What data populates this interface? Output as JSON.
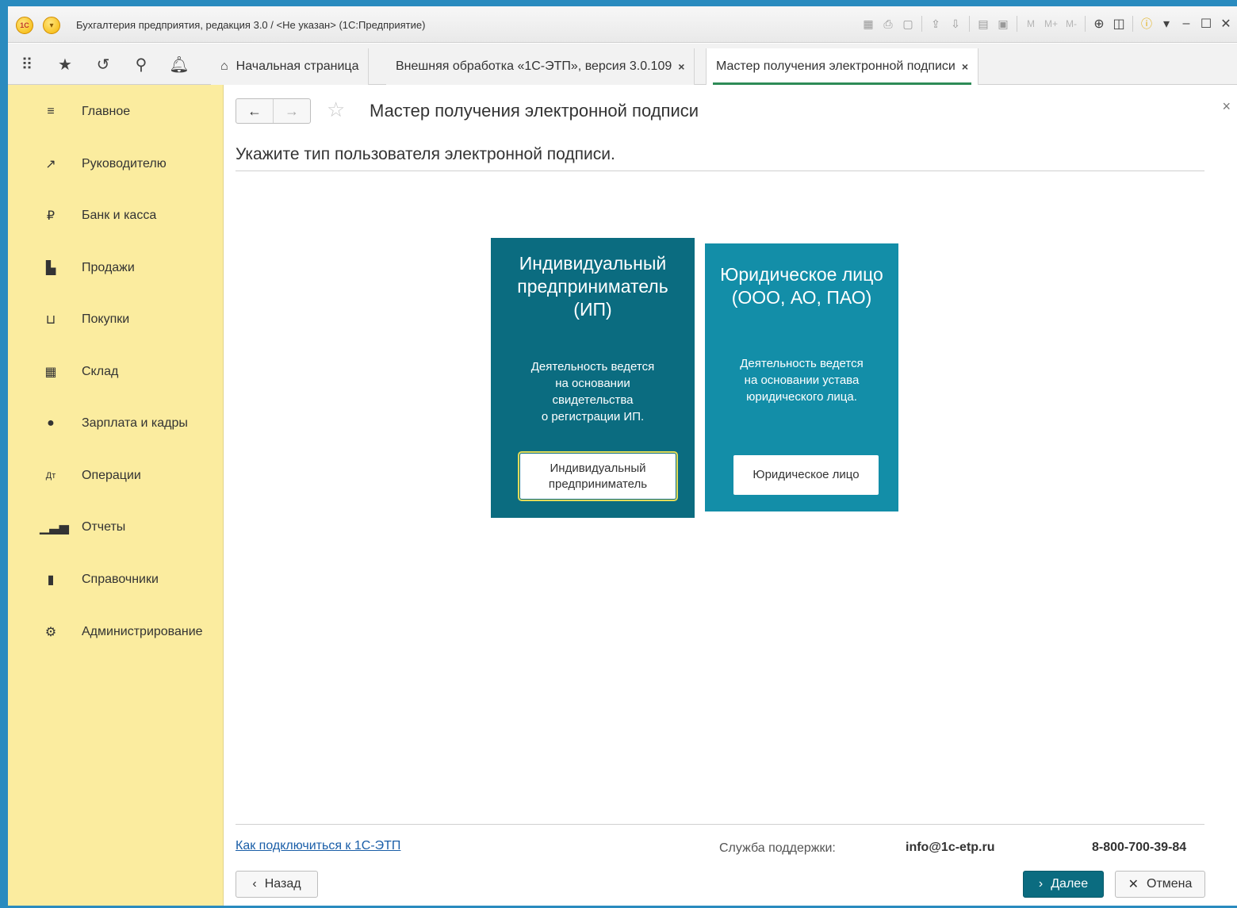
{
  "window": {
    "title": "Бухгалтерия предприятия, редакция 3.0 / <Не указан> (1С:Предприятие)",
    "logo_text": "1С",
    "toolbar_icons": [
      "save-icon",
      "print-icon",
      "preview-icon",
      "upload-icon",
      "download-icon",
      "calculator-icon",
      "calendar-icon"
    ],
    "memory_buttons": [
      "M",
      "M+",
      "M-"
    ],
    "window_controls": [
      "minimize-icon",
      "maximize-icon",
      "close-icon"
    ]
  },
  "tabs": [
    {
      "label": "Начальная страница"
    },
    {
      "label": "Внешняя обработка «1С-ЭТП», версия 3.0.109"
    },
    {
      "label": "Мастер получения электронной подписи"
    }
  ],
  "sidebar": {
    "items": [
      {
        "label": "Главное",
        "icon": "menu-icon"
      },
      {
        "label": "Руководителю",
        "icon": "trend-icon"
      },
      {
        "label": "Банк и касса",
        "icon": "ruble-icon"
      },
      {
        "label": "Продажи",
        "icon": "bag-icon"
      },
      {
        "label": "Покупки",
        "icon": "cart-icon"
      },
      {
        "label": "Склад",
        "icon": "warehouse-icon"
      },
      {
        "label": "Зарплата и кадры",
        "icon": "person-icon"
      },
      {
        "label": "Операции",
        "icon": "dt-kt-icon"
      },
      {
        "label": "Отчеты",
        "icon": "bar-chart-icon"
      },
      {
        "label": "Справочники",
        "icon": "book-icon"
      },
      {
        "label": "Администрирование",
        "icon": "gear-icon"
      }
    ]
  },
  "form": {
    "title": "Мастер получения электронной подписи",
    "prompt": "Укажите тип пользователя электронной подписи."
  },
  "cards": {
    "ip": {
      "title": [
        "Индивидуальный",
        "предприниматель",
        "(ИП)"
      ],
      "desc": [
        "Деятельность ведется",
        "на основании",
        "свидетельства",
        "о регистрации ИП."
      ],
      "button": [
        "Индивидуальный",
        "предприниматель"
      ],
      "color": "#0b6c80"
    },
    "ul": {
      "title": [
        "Юридическое лицо",
        "(ООО, АО, ПАО)"
      ],
      "desc": [
        "Деятельность ведется",
        "на основании устава",
        "юридического лица."
      ],
      "button": "Юридическое лицо",
      "color": "#138ea8"
    }
  },
  "footer": {
    "help_link": "Как подключиться к 1С-ЭТП",
    "support_label": "Служба поддержки:",
    "support_email": "info@1c-etp.ru",
    "support_phone": "8-800-700-39-84",
    "back_label": "Назад",
    "next_label": "Далее",
    "cancel_label": "Отмена"
  },
  "colors": {
    "accent": "#0b6c80",
    "sidebar_bg": "#fbec9f",
    "active_tab_underline": "#2e8b57",
    "link": "#1a5ea8"
  }
}
